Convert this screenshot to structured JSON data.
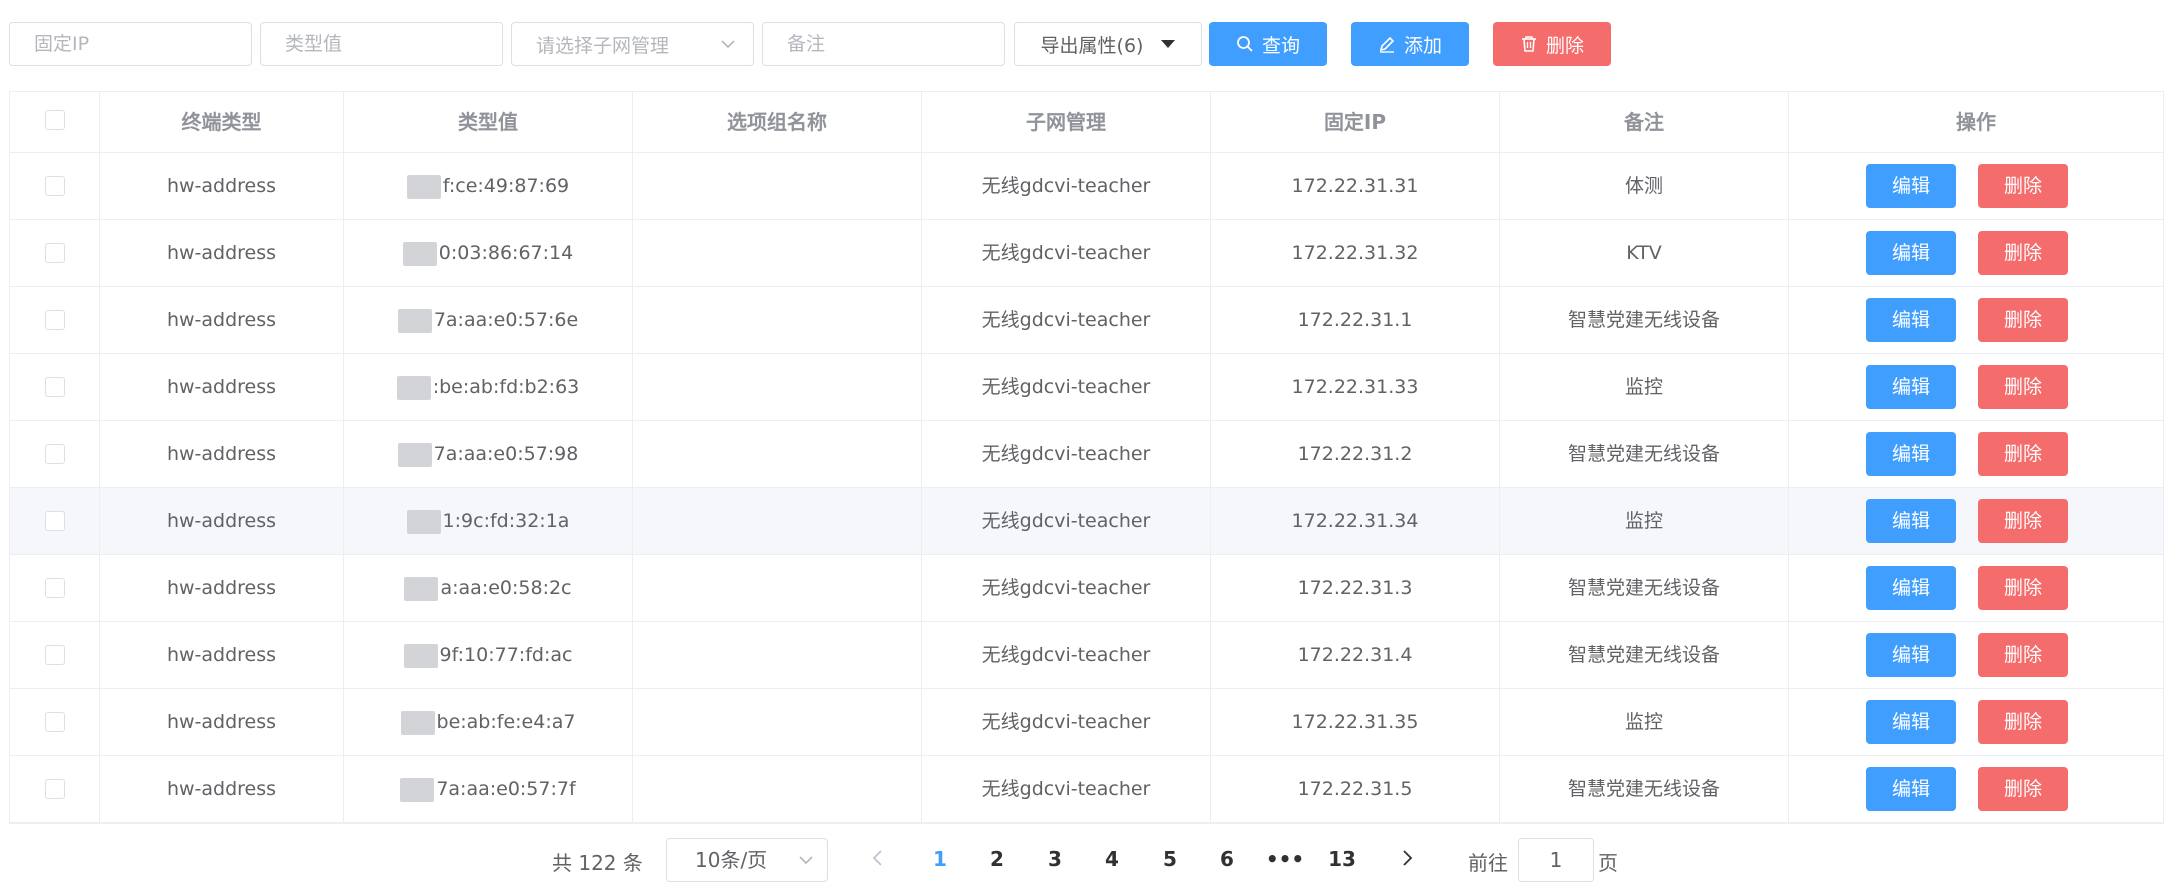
{
  "filters": {
    "fixed_ip_placeholder": "固定IP",
    "type_value_placeholder": "类型值",
    "subnet_select_placeholder": "请选择子网管理",
    "remark_placeholder": "备注",
    "export_label": "导出属性(6)",
    "query_label": "查询",
    "add_label": "添加",
    "delete_label": "删除"
  },
  "colors": {
    "primary": "#409eff",
    "danger": "#f56c6c",
    "border": "#dcdfe6",
    "header_text": "#909399"
  },
  "table": {
    "columns": [
      "终端类型",
      "类型值",
      "选项组名称",
      "子网管理",
      "固定IP",
      "备注",
      "操作"
    ],
    "edit_label": "编辑",
    "delete_label": "删除",
    "rows": [
      {
        "terminal_type": "hw-address",
        "type_value": "f:ce:49:87:69",
        "option_group": "",
        "subnet": "无线gdcvi-teacher",
        "fixed_ip": "172.22.31.31",
        "remark": "体测"
      },
      {
        "terminal_type": "hw-address",
        "type_value": "0:03:86:67:14",
        "option_group": "",
        "subnet": "无线gdcvi-teacher",
        "fixed_ip": "172.22.31.32",
        "remark": "KTV"
      },
      {
        "terminal_type": "hw-address",
        "type_value": "7a:aa:e0:57:6e",
        "option_group": "",
        "subnet": "无线gdcvi-teacher",
        "fixed_ip": "172.22.31.1",
        "remark": "智慧党建无线设备"
      },
      {
        "terminal_type": "hw-address",
        "type_value": ":be:ab:fd:b2:63",
        "option_group": "",
        "subnet": "无线gdcvi-teacher",
        "fixed_ip": "172.22.31.33",
        "remark": "监控"
      },
      {
        "terminal_type": "hw-address",
        "type_value": "7a:aa:e0:57:98",
        "option_group": "",
        "subnet": "无线gdcvi-teacher",
        "fixed_ip": "172.22.31.2",
        "remark": "智慧党建无线设备"
      },
      {
        "terminal_type": "hw-address",
        "type_value": "1:9c:fd:32:1a",
        "option_group": "",
        "subnet": "无线gdcvi-teacher",
        "fixed_ip": "172.22.31.34",
        "remark": "监控"
      },
      {
        "terminal_type": "hw-address",
        "type_value": "a:aa:e0:58:2c",
        "option_group": "",
        "subnet": "无线gdcvi-teacher",
        "fixed_ip": "172.22.31.3",
        "remark": "智慧党建无线设备"
      },
      {
        "terminal_type": "hw-address",
        "type_value": "9f:10:77:fd:ac",
        "option_group": "",
        "subnet": "无线gdcvi-teacher",
        "fixed_ip": "172.22.31.4",
        "remark": "智慧党建无线设备"
      },
      {
        "terminal_type": "hw-address",
        "type_value": "be:ab:fe:e4:a7",
        "option_group": "",
        "subnet": "无线gdcvi-teacher",
        "fixed_ip": "172.22.31.35",
        "remark": "监控"
      },
      {
        "terminal_type": "hw-address",
        "type_value": "7a:aa:e0:57:7f",
        "option_group": "",
        "subnet": "无线gdcvi-teacher",
        "fixed_ip": "172.22.31.5",
        "remark": "智慧党建无线设备"
      }
    ]
  },
  "pagination": {
    "total": "共 122 条",
    "page_size": "10条/页",
    "pages": [
      "1",
      "2",
      "3",
      "4",
      "5",
      "6",
      "•••",
      "13"
    ],
    "current": "1",
    "goto_label": "前往",
    "goto_value": "1",
    "page_suffix": "页"
  }
}
